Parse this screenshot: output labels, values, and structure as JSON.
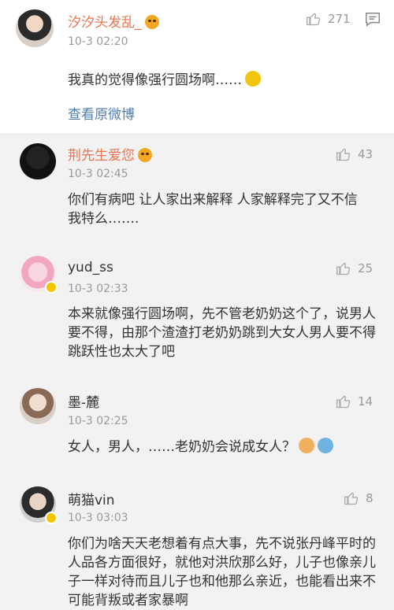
{
  "main_post": {
    "username": "汐汐头发乱_",
    "time": "10-3 02:20",
    "likes": "271",
    "text": "我真的觉得像强行圆场啊……",
    "view_original": "查看原微博"
  },
  "comments": [
    {
      "username": "荆先生爱您",
      "time": "10-3 02:45",
      "likes": "43",
      "text": "你们有病吧 让人家出来解释 人家解释完了又不信 我特么……."
    },
    {
      "username": "yud_ss",
      "time": "10-3 02:33",
      "likes": "25",
      "text": "本来就像强行圆场啊，先不管老奶奶这个了，说男人要不得，由那个渣渣打老奶奶跳到大女人男人要不得跳跃性也太大了吧"
    },
    {
      "username": "墨-麓",
      "time": "10-3 02:25",
      "likes": "14",
      "text": "女人，男人，……老奶奶会说成女人？"
    },
    {
      "username": "萌猫vin",
      "time": "10-3 03:03",
      "likes": "8",
      "text": "你们为啥天天老想着有点大事，先不说张丹峰平时的人品各方面很好，就他对洪欣那么好，儿子也像亲儿子一样对待而且儿子也和他那么亲近，也能看出来不可能背叛或者家暴啊"
    }
  ],
  "colors": {
    "vip_name": "#eb7350",
    "link": "#507daf",
    "meta": "#9a9a9a"
  },
  "icons": {
    "like": "thumbs-up-icon",
    "comment": "comment-icon",
    "vip": "vip-emoji-icon"
  }
}
